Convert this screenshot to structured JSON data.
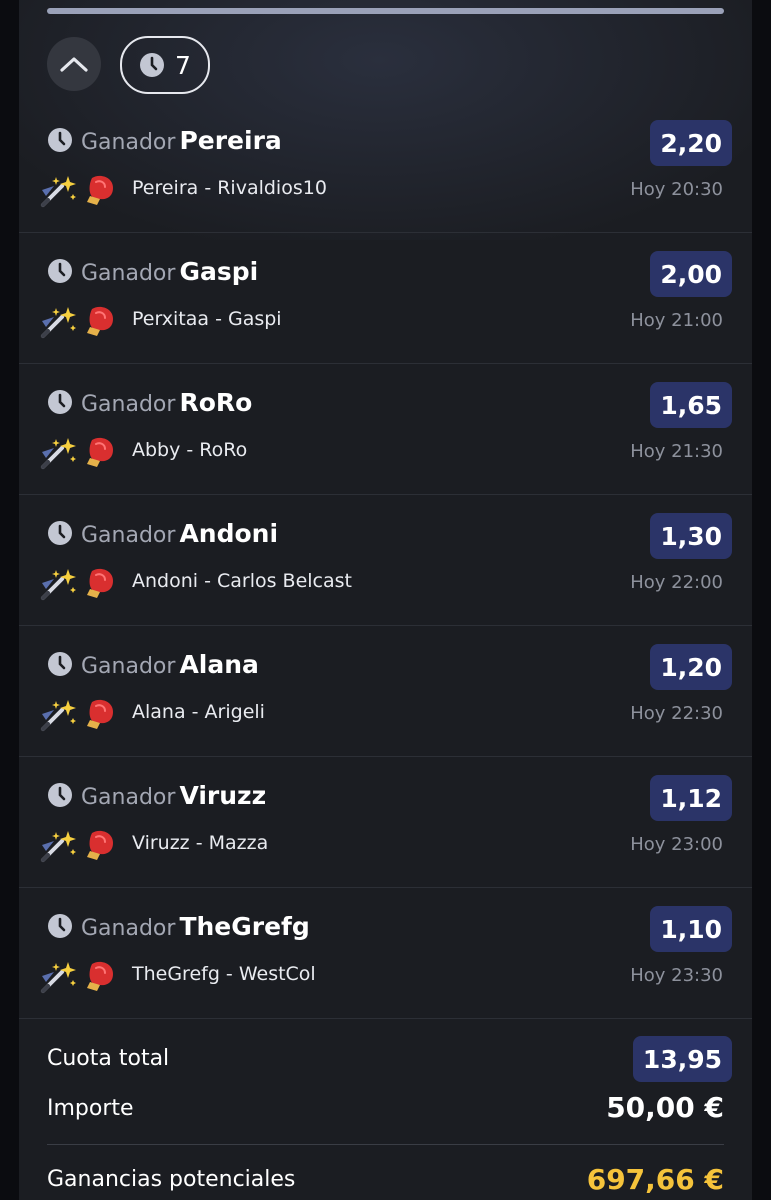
{
  "header": {
    "bet_count": "7"
  },
  "bets": [
    {
      "market": "Ganador",
      "selection": "Pereira",
      "event": "Pereira - Rivaldios10",
      "odds": "2,20",
      "time": "Hoy 20:30"
    },
    {
      "market": "Ganador",
      "selection": "Gaspi",
      "event": "Perxitaa - Gaspi",
      "odds": "2,00",
      "time": "Hoy 21:00"
    },
    {
      "market": "Ganador",
      "selection": "RoRo",
      "event": "Abby - RoRo",
      "odds": "1,65",
      "time": "Hoy 21:30"
    },
    {
      "market": "Ganador",
      "selection": "Andoni",
      "event": "Andoni - Carlos Belcast",
      "odds": "1,30",
      "time": "Hoy 22:00"
    },
    {
      "market": "Ganador",
      "selection": "Alana",
      "event": "Alana - Arigeli",
      "odds": "1,20",
      "time": "Hoy 22:30"
    },
    {
      "market": "Ganador",
      "selection": "Viruzz",
      "event": "Viruzz - Mazza",
      "odds": "1,12",
      "time": "Hoy 23:00"
    },
    {
      "market": "Ganador",
      "selection": "TheGrefg",
      "event": "TheGrefg - WestCol",
      "odds": "1,10",
      "time": "Hoy 23:30"
    }
  ],
  "summary": {
    "total_odds_label": "Cuota total",
    "total_odds": "13,95",
    "stake_label": "Importe",
    "stake": "50,00 €",
    "winnings_label": "Ganancias potenciales",
    "winnings": "697,66 €"
  },
  "icons": {
    "collapse": "chevron-up-icon",
    "clock": "clock-icon",
    "wand": "magic-wand-icon",
    "glove": "boxing-glove-icon"
  },
  "colors": {
    "panel_bg": "#1b1d22",
    "odds_badge": "#2b3468",
    "winnings": "#f5c33b"
  }
}
